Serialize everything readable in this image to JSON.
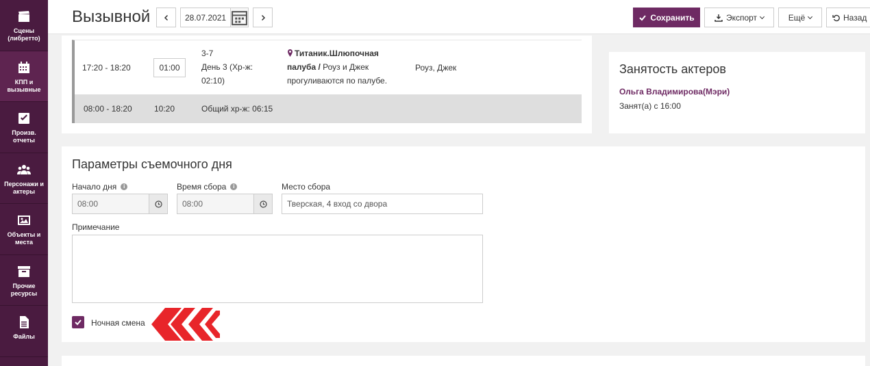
{
  "sidebar": {
    "items": [
      {
        "label": "Сцены (либретто)",
        "icon": "clapperboard-icon"
      },
      {
        "label": "КПП и вызывные",
        "icon": "calendar-icon"
      },
      {
        "label": "Произв. отчеты",
        "icon": "checkbox-icon"
      },
      {
        "label": "Персонажи и актеры",
        "icon": "people-icon"
      },
      {
        "label": "Объекты и места",
        "icon": "image-icon"
      },
      {
        "label": "Прочие ресурсы",
        "icon": "archive-icon"
      },
      {
        "label": "Файлы",
        "icon": "file-icon"
      }
    ]
  },
  "header": {
    "title": "Вызывной",
    "date": "28.07.2021",
    "save_label": "Сохранить",
    "export_label": "Экспорт",
    "more_label": "Ещё",
    "back_label": "Назад"
  },
  "schedule": {
    "row": {
      "time": "17:20 - 18:20",
      "duration": "01:00",
      "scene_line1": "3-7",
      "scene_line2": "День 3 (Хр-ж:",
      "scene_line3": "02:10)",
      "location_bold1": "Титаник.Шлюпочная",
      "location_bold2": "палуба /",
      "desc_part1": " Роуз и Джек",
      "desc_part2": "прогуливаются по палубе.",
      "characters": "Роуз, Джек"
    },
    "total": {
      "time": "08:00 - 18:20",
      "duration": "10:20",
      "chronometry": "Общий хр-ж: 06:15"
    }
  },
  "occupancy": {
    "title": "Занятость актеров",
    "actor_name": "Ольга Владимирова(Мэри)",
    "actor_status": "Занят(а) с 16:00"
  },
  "params": {
    "title": "Параметры съемочного дня",
    "start_label": "Начало дня",
    "start_value": "08:00",
    "gather_label": "Время сбора",
    "gather_value": "08:00",
    "place_label": "Место сбора",
    "place_value": "Тверская, 4 вход со двора",
    "note_label": "Примечание",
    "night_label": "Ночная смена"
  },
  "colors": {
    "sidebar": "#4a1b40",
    "accent": "#6e2a63",
    "annotation_arrow": "#e8252a"
  }
}
